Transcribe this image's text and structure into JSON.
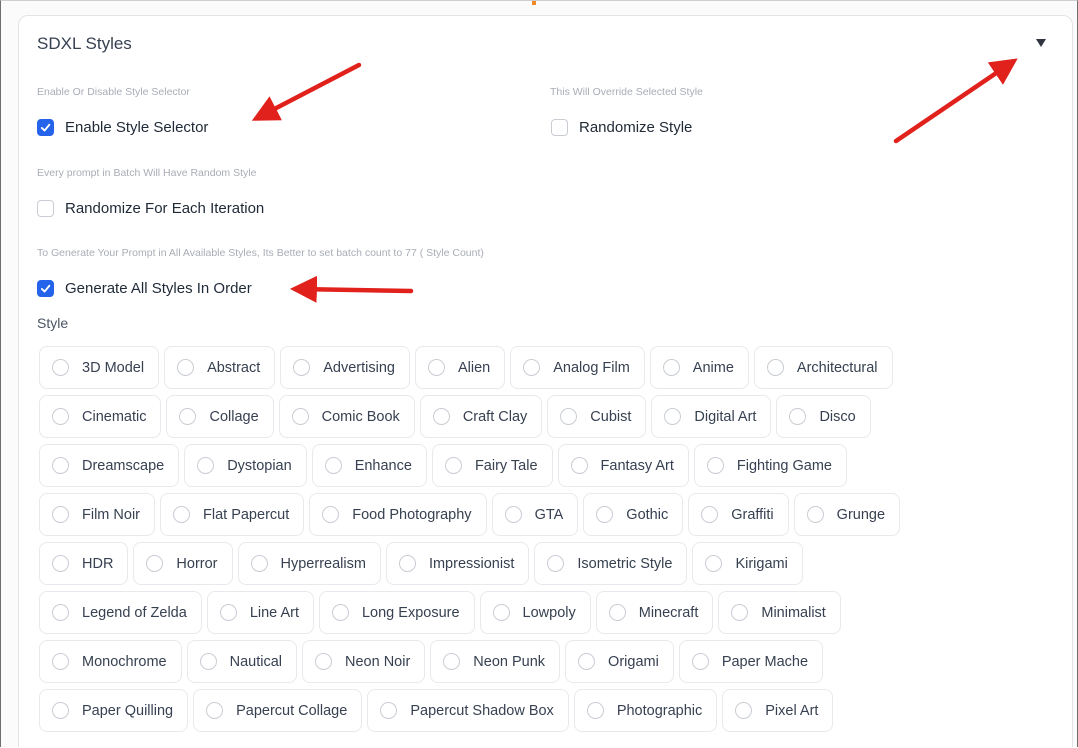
{
  "panel": {
    "title": "SDXL Styles"
  },
  "options": {
    "enable_selector": {
      "info": "Enable Or Disable Style Selector",
      "label": "Enable Style Selector",
      "checked": true
    },
    "randomize_style": {
      "info": "This Will Override Selected Style",
      "label": "Randomize Style",
      "checked": false
    },
    "randomize_each": {
      "info": "Every prompt in Batch Will Have Random Style",
      "label": "Randomize For Each Iteration",
      "checked": false
    },
    "generate_all": {
      "info": "To Generate Your Prompt in All Available Styles, Its Better to set batch count to 77 ( Style Count)",
      "label": "Generate All Styles In Order",
      "checked": true
    }
  },
  "styles": {
    "label": "Style",
    "rows": [
      [
        "3D Model",
        "Abstract",
        "Advertising",
        "Alien",
        "Analog Film",
        "Anime",
        "Architectural"
      ],
      [
        "Cinematic",
        "Collage",
        "Comic Book",
        "Craft Clay",
        "Cubist",
        "Digital Art",
        "Disco"
      ],
      [
        "Dreamscape",
        "Dystopian",
        "Enhance",
        "Fairy Tale",
        "Fantasy Art",
        "Fighting Game"
      ],
      [
        "Film Noir",
        "Flat Papercut",
        "Food Photography",
        "GTA",
        "Gothic",
        "Graffiti",
        "Grunge"
      ],
      [
        "HDR",
        "Horror",
        "Hyperrealism",
        "Impressionist",
        "Isometric Style",
        "Kirigami"
      ],
      [
        "Legend of Zelda",
        "Line Art",
        "Long Exposure",
        "Lowpoly",
        "Minecraft",
        "Minimalist"
      ],
      [
        "Monochrome",
        "Nautical",
        "Neon Noir",
        "Neon Punk",
        "Origami",
        "Paper Mache"
      ],
      [
        "Paper Quilling",
        "Papercut Collage",
        "Papercut Shadow Box",
        "Photographic",
        "Pixel Art"
      ]
    ]
  },
  "colors": {
    "accent": "#2563eb",
    "annotation_arrow": "#e0211c"
  },
  "icons": {
    "collapse": "triangle-down-icon",
    "checkmark": "checkmark-icon",
    "radio": "radio-circle-icon"
  }
}
